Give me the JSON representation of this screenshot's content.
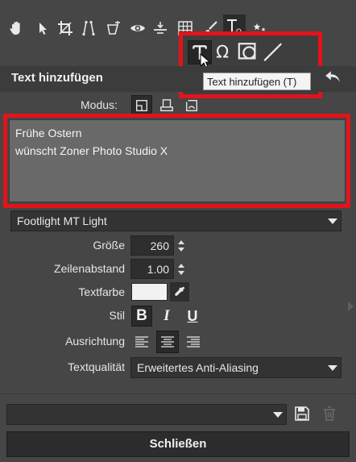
{
  "toolbar": {
    "icons": [
      "hand-icon",
      "select-arrow-icon",
      "crop-icon",
      "straighten-icon",
      "warp-icon",
      "redeye-icon",
      "level-icon",
      "grid-icon",
      "brush-icon",
      "text-omega-icon",
      "effects-icon"
    ]
  },
  "text_tools": {
    "tooltip": "Text hinzufügen (T)"
  },
  "panel": {
    "title": "Text hinzufügen"
  },
  "mode": {
    "label": "Modus:"
  },
  "text_area": {
    "value": "Frühe Ostern\nwünscht Zoner Photo Studio X"
  },
  "font": {
    "selected": "Footlight MT Light"
  },
  "size": {
    "label": "Größe",
    "value": "260"
  },
  "line_spacing": {
    "label": "Zeilenabstand",
    "value": "1.00"
  },
  "text_color": {
    "label": "Textfarbe",
    "color": "#f2f2f2"
  },
  "style": {
    "label": "Stil",
    "bold": "B",
    "italic": "I",
    "underline": "U"
  },
  "alignment": {
    "label": "Ausrichtung",
    "selected": "center"
  },
  "quality": {
    "label": "Textqualität",
    "selected": "Erweitertes Anti-Aliasing"
  },
  "preset": {
    "selected": ""
  },
  "close_button": {
    "label": "Schließen"
  },
  "colors": {
    "highlight": "#e3131b",
    "panel": "#464646",
    "field": "#2e2e2e"
  }
}
